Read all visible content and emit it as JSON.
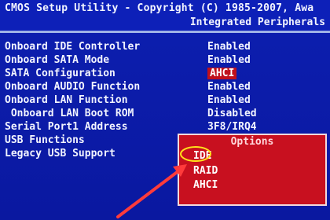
{
  "header": {
    "title": "CMOS Setup Utility - Copyright (C) 1985-2007, Awa",
    "subtitle": "Integrated Peripherals"
  },
  "settings": [
    {
      "label": "Onboard IDE Controller",
      "value": "Enabled"
    },
    {
      "label": "Onboard SATA Mode",
      "value": "Enabled"
    },
    {
      "label": "SATA Configuration",
      "value": "AHCI"
    },
    {
      "label": "Onboard AUDIO Function",
      "value": "Enabled"
    },
    {
      "label": "Onboard LAN Function",
      "value": "Enabled"
    },
    {
      "label": " Onboard LAN Boot ROM",
      "value": "Disabled"
    },
    {
      "label": "Serial Port1 Address",
      "value": "3F8/IRQ4"
    },
    {
      "label": "USB Functions",
      "value": ""
    },
    {
      "label": "Legacy USB Support",
      "value": ""
    }
  ],
  "popup": {
    "title": "Options",
    "options": [
      "IDE",
      "RAID",
      "AHCI"
    ]
  },
  "colors": {
    "background": "#0b1aa8",
    "popup": "#c8101f",
    "annotation": "#ffe21a",
    "arrow": "#ff3b3b"
  }
}
